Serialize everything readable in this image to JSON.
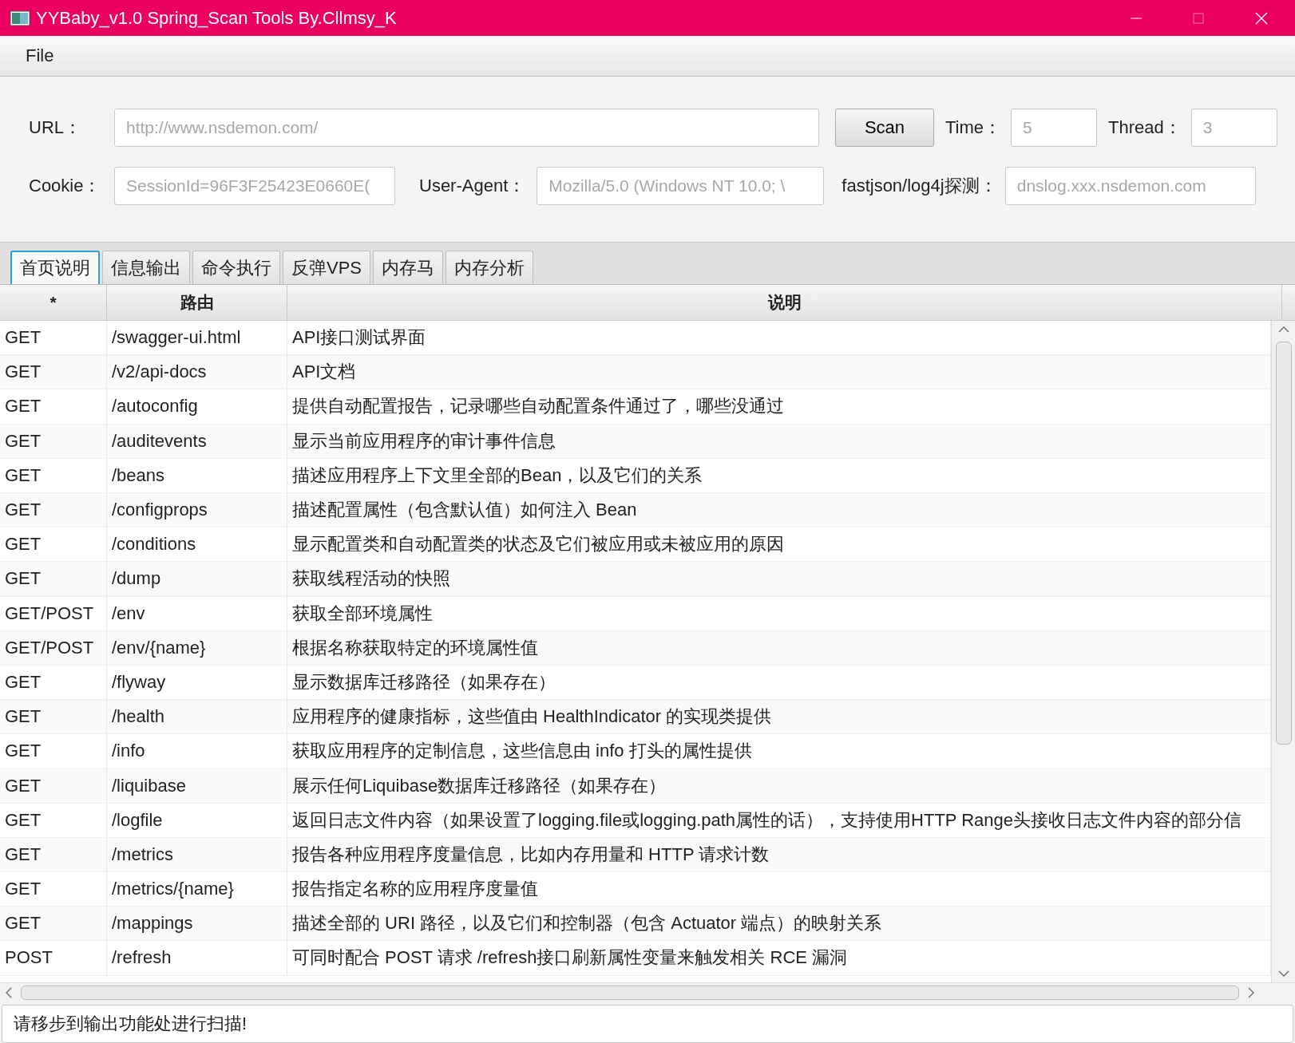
{
  "window": {
    "title": "YYBaby_v1.0 Spring_Scan Tools By.Cllmsy_K"
  },
  "menu": [
    "File"
  ],
  "form": {
    "url": {
      "label": "URL：",
      "placeholder": "http://www.nsdemon.com/"
    },
    "scan_button": "Scan",
    "time": {
      "label": "Time：",
      "placeholder": "5"
    },
    "thread": {
      "label": "Thread：",
      "placeholder": "3"
    },
    "cookie": {
      "label": "Cookie：",
      "placeholder": "SessionId=96F3F25423E0660E("
    },
    "user_agent": {
      "label": "User-Agent：",
      "placeholder": "Mozilla/5.0 (Windows NT 10.0; \\"
    },
    "dnslog": {
      "label": "fastjson/log4j探测：",
      "placeholder": "dnslog.xxx.nsdemon.com"
    }
  },
  "tabs": [
    {
      "label": "首页说明",
      "selected": true
    },
    {
      "label": "信息输出",
      "selected": false
    },
    {
      "label": "命令执行",
      "selected": false
    },
    {
      "label": "反弹VPS",
      "selected": false
    },
    {
      "label": "内存马",
      "selected": false
    },
    {
      "label": "内存分析",
      "selected": false
    }
  ],
  "table": {
    "columns": [
      "*",
      "路由",
      "说明"
    ],
    "rows": [
      [
        "GET",
        "/swagger-ui.html",
        "API接口测试界面"
      ],
      [
        "GET",
        "/v2/api-docs",
        "API文档"
      ],
      [
        "GET",
        "/autoconfig",
        "提供自动配置报告，记录哪些自动配置条件通过了，哪些没通过"
      ],
      [
        "GET",
        "/auditevents",
        "显示当前应用程序的审计事件信息"
      ],
      [
        "GET",
        "/beans",
        "描述应用程序上下文里全部的Bean，以及它们的关系"
      ],
      [
        "GET",
        "/configprops",
        "描述配置属性（包含默认值）如何注入 Bean"
      ],
      [
        "GET",
        "/conditions",
        "显示配置类和自动配置类的状态及它们被应用或未被应用的原因"
      ],
      [
        "GET",
        "/dump",
        "获取线程活动的快照"
      ],
      [
        "GET/POST",
        "/env",
        "获取全部环境属性"
      ],
      [
        "GET/POST",
        "/env/{name}",
        "根据名称获取特定的环境属性值"
      ],
      [
        "GET",
        "/flyway",
        "显示数据库迁移路径（如果存在）"
      ],
      [
        "GET",
        "/health",
        "应用程序的健康指标，这些值由 HealthIndicator 的实现类提供"
      ],
      [
        "GET",
        "/info",
        "获取应用程序的定制信息，这些信息由 info 打头的属性提供"
      ],
      [
        "GET",
        "/liquibase",
        "展示任何Liquibase数据库迁移路径（如果存在）"
      ],
      [
        "GET",
        "/logfile",
        "返回日志文件内容（如果设置了logging.file或logging.path属性的话），支持使用HTTP Range头接收日志文件内容的部分信"
      ],
      [
        "GET",
        "/metrics",
        "报告各种应用程序度量信息，比如内存用量和 HTTP 请求计数"
      ],
      [
        "GET",
        "/metrics/{name}",
        "报告指定名称的应用程序度量值"
      ],
      [
        "GET",
        "/mappings",
        "描述全部的 URI 路径，以及它们和控制器（包含 Actuator 端点）的映射关系"
      ],
      [
        "POST",
        "/refresh",
        "可同时配合 POST 请求 /refresh接口刷新属性变量来触发相关 RCE 漏洞"
      ]
    ]
  },
  "status_field": {
    "value": "请移步到输出功能处进行扫描!"
  }
}
